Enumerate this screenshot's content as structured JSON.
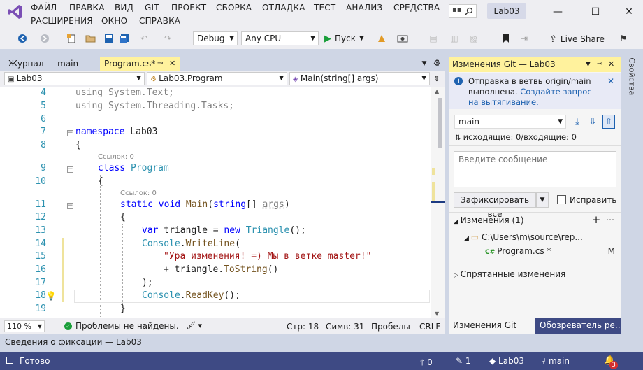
{
  "menu": {
    "items": [
      "ФАЙЛ",
      "ПРАВКА",
      "ВИД",
      "GIT",
      "ПРОЕКТ",
      "СБОРКА",
      "ОТЛАДКА",
      "ТЕСТ",
      "АНАЛИЗ",
      "СРЕДСТВА",
      "РАСШИРЕНИЯ",
      "ОКНО",
      "СПРАВКА"
    ],
    "search_icon": "search-icon",
    "solution_name": "Lab03"
  },
  "toolbar": {
    "config": "Debug",
    "platform": "Any CPU",
    "start_label": "Пуск",
    "live_share": "Live Share"
  },
  "doc_tabs": {
    "journal": "Журнал — main",
    "program": "Program.cs*"
  },
  "nav": {
    "project": "Lab03",
    "class": "Lab03.Program",
    "member": "Main(string[] args)"
  },
  "editor": {
    "line_numbers": [
      "4",
      "5",
      "6",
      "7",
      "8",
      "9",
      "10",
      "11",
      "12",
      "13",
      "14",
      "15",
      "16",
      "17",
      "18",
      "19"
    ],
    "refs": [
      "Ссылок: 0",
      "Ссылок: 0"
    ],
    "lines": {
      "l4a": "using",
      "l4b": " System.Text;",
      "l5a": "using",
      "l5b": " System.Threading.Tasks;",
      "l7a": "namespace",
      "l7b": " Lab03",
      "l8": "{",
      "l9a": "class",
      "l9b": " Program",
      "l10": "{",
      "l11a": "static",
      "l11b": " void",
      "l11c": " Main",
      "l11d": "(",
      "l11e": "string",
      "l11f": "[] ",
      "l11g": "args",
      "l11h": ")",
      "l12": "{",
      "l13a": "var",
      "l13b": " triangle = ",
      "l13c": "new",
      "l13d": " Triangle",
      "l13e": "();",
      "l14a": "Console",
      "l14b": ".",
      "l14c": "WriteLine",
      "l14d": "(",
      "l15": "\"Ура изменения! =) Мы в ветке master!\"",
      "l16a": "+ triangle.",
      "l16b": "ToString",
      "l16c": "()",
      "l17": ");",
      "l18a": "Console",
      "l18b": ".",
      "l18c": "ReadKey",
      "l18d": "();",
      "l19": "}"
    }
  },
  "editor_status": {
    "zoom": "110 %",
    "problems": "Проблемы не найдены.",
    "line": "Стр: 18",
    "col": "Симв: 31",
    "spaces": "Пробелы",
    "eol": "CRLF"
  },
  "git_panel": {
    "title": "Изменения Git — Lab03",
    "info_text": "Отправка в ветвь origin/main выполнена.",
    "info_link": "Создайте запрос на вытягивание.",
    "branch": "main",
    "sync": "исходящие: 0/входящие: 0",
    "message_placeholder": "Введите сообщение",
    "commit_all": "Зафиксировать все",
    "amend": "Исправить",
    "changes_header": "Изменения (1)",
    "folder": "C:\\Users\\m\\source\\rep...",
    "file": "Program.cs *",
    "file_status": "M",
    "stashes": "Спрятанные изменения",
    "tab1": "Изменения Git —...",
    "tab2": "Обозреватель ре..."
  },
  "side_tab": "Свойства",
  "commit_bar": "Сведения о фиксации — Lab03",
  "status": {
    "ready": "Готово",
    "up": "0",
    "pencil": "1",
    "repo": "Lab03",
    "branch": "main",
    "notif": "3"
  },
  "colors": {
    "statusbar": "#3e4a84",
    "git_title": "#fff29d",
    "keyword": "#0000ff",
    "type": "#2b91af",
    "string": "#a31515"
  }
}
